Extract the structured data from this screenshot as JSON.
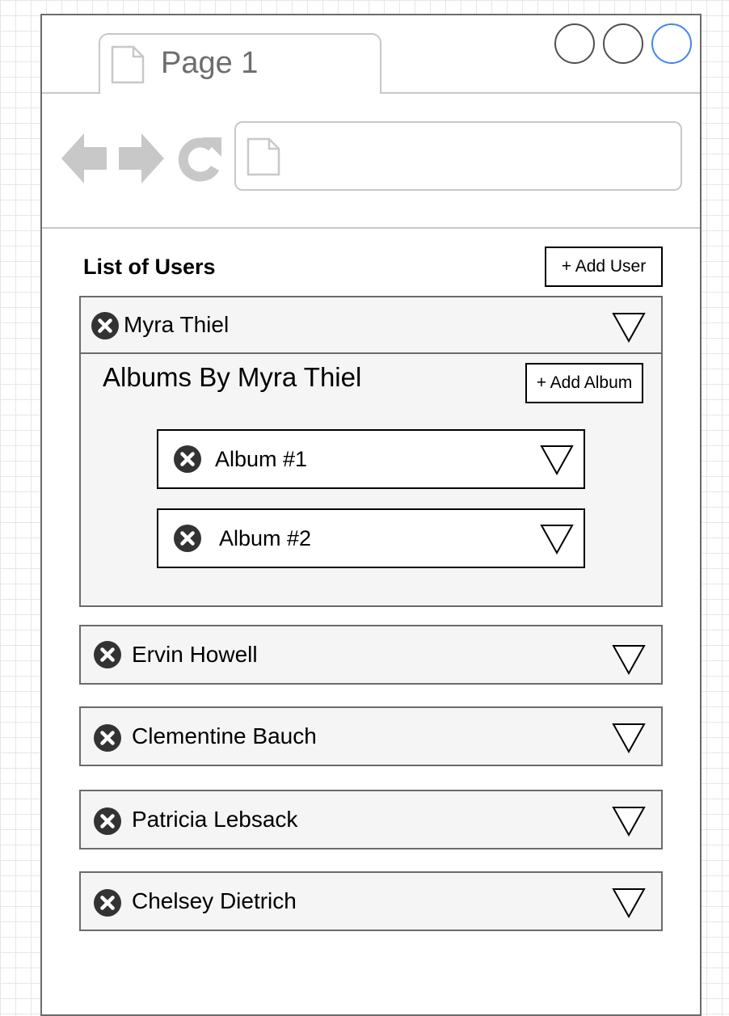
{
  "browser": {
    "tab_title": "Page 1",
    "address_value": "",
    "window_controls": [
      "circle",
      "circle",
      "circle-active"
    ],
    "active_control_color": "#3f86f0",
    "icons": [
      "document-icon",
      "back-arrow-icon",
      "forward-arrow-icon",
      "reload-icon"
    ]
  },
  "main": {
    "heading": "List of Users",
    "add_user_label": "+ Add User",
    "users": [
      {
        "name": "Myra Thiel",
        "expanded": true,
        "albums_heading": "Albums By Myra Thiel",
        "add_album_label": "+ Add Album",
        "albums": [
          {
            "title": "Album #1"
          },
          {
            "title": "Album #2"
          }
        ]
      },
      {
        "name": "Ervin Howell",
        "expanded": false
      },
      {
        "name": "Clementine Bauch",
        "expanded": false
      },
      {
        "name": "Patricia Lebsack",
        "expanded": false
      },
      {
        "name": "Chelsey Dietrich",
        "expanded": false
      }
    ]
  },
  "icons": {
    "delete": "close-circle-icon",
    "expand": "triangle-down-icon"
  }
}
